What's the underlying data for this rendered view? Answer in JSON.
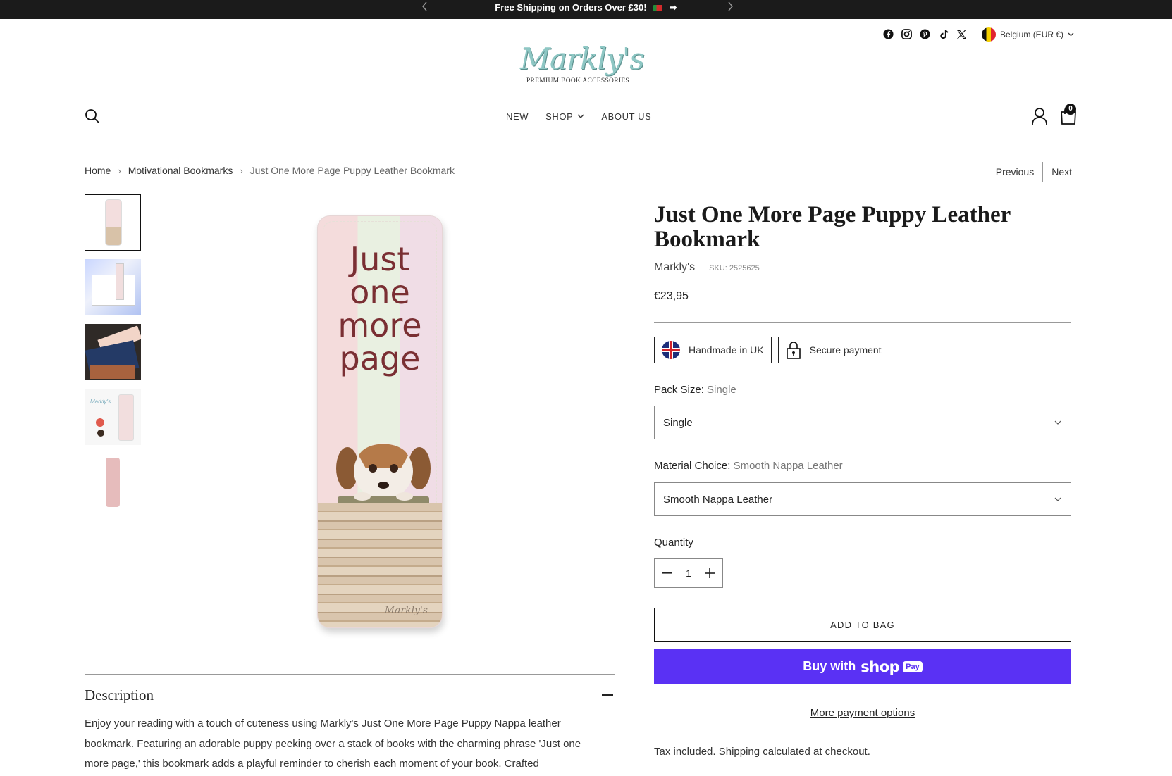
{
  "announcement": {
    "message": "Free Shipping on Orders Over £30!",
    "prev_icon": "chevron-left-icon",
    "next_icon": "chevron-right-icon"
  },
  "header": {
    "social_icons": [
      "facebook-icon",
      "instagram-icon",
      "pinterest-icon",
      "tiktok-icon",
      "x-icon"
    ],
    "locale": "Belgium (EUR €)",
    "logo_text": "Markly's",
    "logo_tagline": "PREMIUM BOOK ACCESSORIES",
    "nav": [
      {
        "label": "NEW"
      },
      {
        "label": "SHOP"
      },
      {
        "label": "ABOUT US"
      }
    ],
    "cart_count": "0"
  },
  "breadcrumb": {
    "items": [
      "Home",
      "Motivational Bookmarks",
      "Just One More Page Puppy Leather Bookmark"
    ],
    "previous": "Previous",
    "next": "Next"
  },
  "gallery": {
    "thumbnail_count": 5,
    "main_quote": [
      "Just",
      "one",
      "more",
      "page"
    ],
    "signature": "Markly's"
  },
  "product": {
    "title": "Just One More Page Puppy Leather Bookmark",
    "vendor": "Markly's",
    "sku": "SKU: 2525625",
    "price": "€23,95",
    "badges": [
      "Handmade in UK",
      "Secure payment"
    ],
    "pack_size_label": "Pack Size:",
    "pack_size_value": "Single",
    "pack_size_selected": "Single",
    "material_label": "Material Choice:",
    "material_value": "Smooth Nappa Leather",
    "material_selected": "Smooth Nappa Leather",
    "quantity_label": "Quantity",
    "quantity": "1",
    "add_to_bag": "ADD TO BAG",
    "buy_with": "Buy with",
    "shop_text": "shop",
    "pay_text": "Pay",
    "more_payment": "More payment options",
    "tax_prefix": "Tax included.",
    "shipping_link": "Shipping",
    "tax_suffix": "calculated at checkout."
  },
  "description": {
    "heading": "Description",
    "body": "Enjoy your reading with a touch of cuteness using Markly's Just One More Page Puppy Nappa leather bookmark. Featuring an adorable puppy peeking over a stack of books with the charming phrase 'Just one more page,' this bookmark adds a playful reminder to cherish each moment of your book. Crafted"
  },
  "colors": {
    "shop_pay": "#5a31f4",
    "announcement_bg": "#1b1b1b",
    "logo_teal": "#8ec7c4"
  }
}
